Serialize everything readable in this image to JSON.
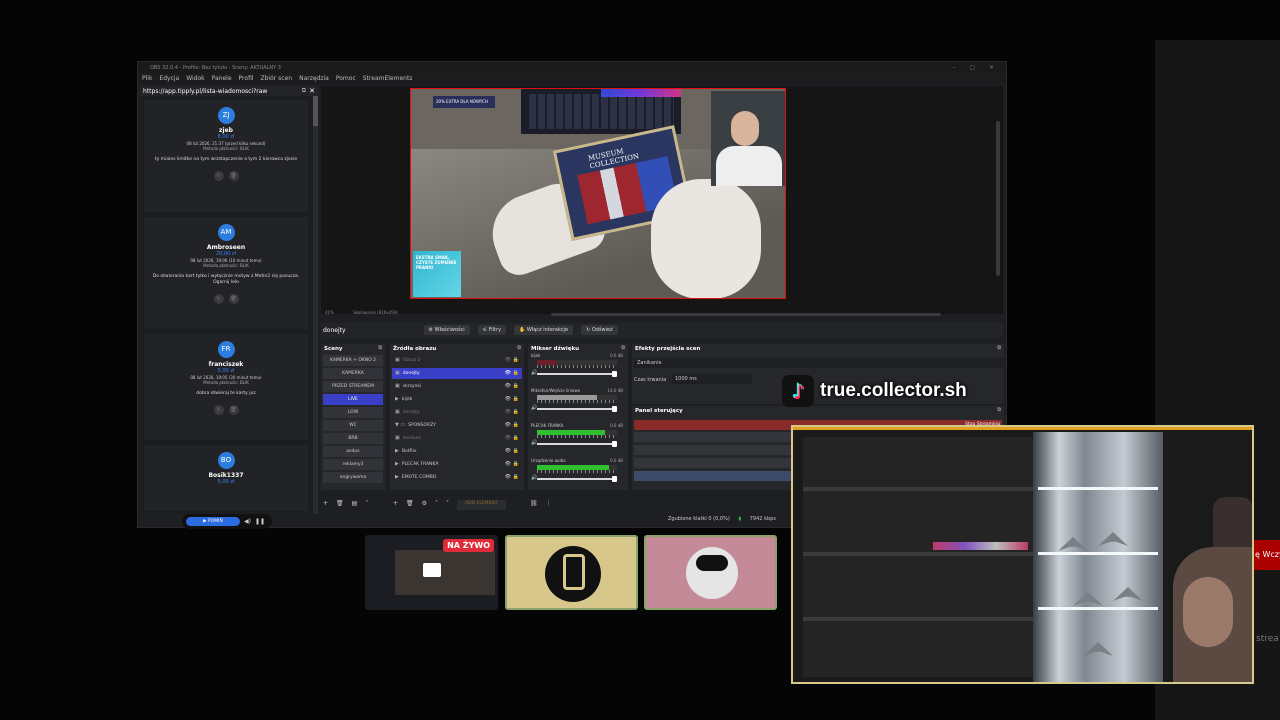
{
  "obs": {
    "title": "OBS 32.0.4 - Profile: Bez tytułu - Sceny: AKTUALNY 3",
    "window_controls": "–  ▢  ✕",
    "menu": [
      "Plik",
      "Edycja",
      "Widok",
      "Panele",
      "Profil",
      "Zbiór scen",
      "Narzędzia",
      "Pomoc",
      "StreamElements"
    ]
  },
  "dock": {
    "url": "https://app.tipply.pl/lista-wiadomosci?raw",
    "messages": [
      {
        "initials": "ZJ",
        "name": "zjeb",
        "amount": "8,00 zł",
        "date": "08 lut 2026, 21:37 (przed kilku sekund)",
        "method": "Metoda płatności: BLIK",
        "text": "ty miales limitke na tym wrzstapczenie a tym 2 kierowca zjesie"
      },
      {
        "initials": "AM",
        "name": "Ambroseen",
        "amount": "20,00 zł",
        "date": "08 lut 2026, 19:06 (10 minut temu)",
        "method": "Metoda płatności: BLIK",
        "text": "Do otwierania kart tylko i wyłącznie motyw z Metin2 się posucza. Ogarnij lelo"
      },
      {
        "initials": "FR",
        "name": "franciszek",
        "amount": "5,00 zł",
        "date": "08 lut 2026, 19:05 (30 minut temu)",
        "method": "Metoda płatności: BLIK",
        "text": "dobra otwieraj te karty juz"
      },
      {
        "initials": "BO",
        "name": "Bosik1337",
        "amount": "5,00 zł",
        "date": "",
        "method": "",
        "text": ""
      }
    ],
    "player": {
      "start_label": "▶  POMIŃ",
      "volume_icon": "◀)",
      "pause_icon": "❚❚"
    }
  },
  "preview": {
    "zoom": "41%",
    "hint": "Skalowanie (816x459)",
    "banner": "20% EXTRA DLA NOWYCH",
    "card_title": "MUSEUM COLLECTION",
    "promo_text": "EKSTRA SMAK, CZYSTE ZUMIENIE PRANIO"
  },
  "source_toolbar": {
    "name": "donejty",
    "buttons": [
      "⚙ Właściwości",
      "⚟ Filtry",
      "✋ Włącz interakcje",
      "↻ Odśwież"
    ]
  },
  "scenes": {
    "header": "Sceny",
    "items": [
      "KAMERKA + OKNO 2",
      "KAMERKA",
      "PRZED STREAMEM",
      "LIVE",
      "LOW",
      "WC",
      "BRB",
      "asdus",
      "reklamy3",
      "angrywama"
    ],
    "active_index": 3
  },
  "sources": {
    "header": "Źródła obrazu",
    "items": [
      {
        "icon": "▣",
        "label": "Obraz 2",
        "dim": true
      },
      {
        "icon": "▣",
        "label": "donejty",
        "selected": true
      },
      {
        "icon": "▣",
        "label": "skrzynki"
      },
      {
        "icon": "▶",
        "label": "kijek"
      },
      {
        "icon": "▣",
        "label": "donejty",
        "dim": true
      },
      {
        "icon": "▼ ▭",
        "label": "SPONSORZY"
      },
      {
        "icon": "▣",
        "label": "meduza",
        "dim": true
      },
      {
        "icon": "▶",
        "label": "BotRix"
      },
      {
        "icon": "▶",
        "label": "PLECAK FRANKA"
      },
      {
        "icon": "▶",
        "label": "EMOTE COMBO"
      }
    ],
    "add_element": "ADD ELEMENT"
  },
  "mixer": {
    "header": "Mikser dźwięku",
    "channels": [
      {
        "name": "kijek",
        "db": "0.0 dB",
        "level": 0.25,
        "color": "#6a1f2a"
      },
      {
        "name": "Mikrofon/Wejście liniowe",
        "db": "14.0 dB",
        "level": 0.75,
        "color": "#9a9a9a"
      },
      {
        "name": "PLECAK FRANKA",
        "db": "0.0 dB",
        "level": 0.85,
        "color": "#2fbf2f"
      },
      {
        "name": "Urządzenie audio",
        "db": "0.0 dB",
        "level": 0.9,
        "color": "#2fbf2f"
      }
    ]
  },
  "transitions": {
    "header": "Efekty przejścia scen",
    "selected": "Zanikanie",
    "duration_label": "Czas trwania",
    "duration": "1000 ms"
  },
  "control": {
    "header": "Panel sterujący",
    "stream_label": "Stop Streaming",
    "rows": [
      "R",
      "Urucho",
      "",
      "Strea"
    ]
  },
  "status": {
    "dropped": "Zgubione klatki 0 (0,0%)",
    "kbps": "7942 kbps"
  },
  "overlay": {
    "tiktok_handle": "true.collector.sh"
  },
  "thumbnails": {
    "live_badge": "NA ŻYWO"
  },
  "right_edge": {
    "red_text": "ę Wczy",
    "grey_text": "strea"
  }
}
